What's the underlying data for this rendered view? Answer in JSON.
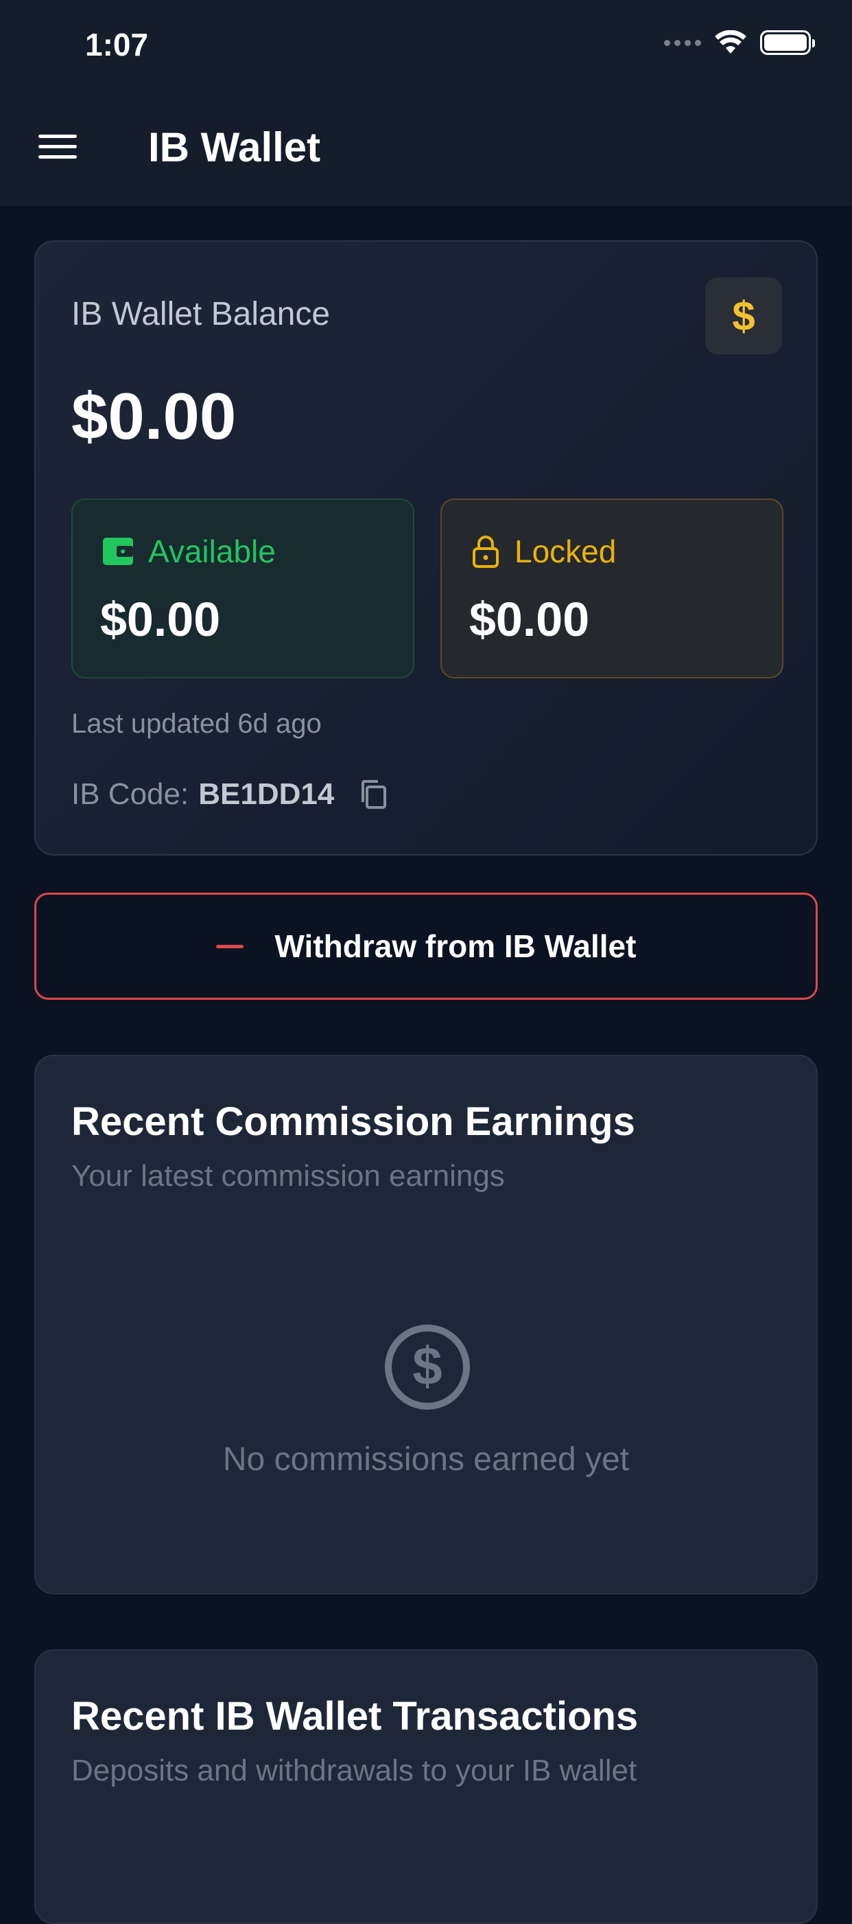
{
  "status_bar": {
    "time": "1:07"
  },
  "header": {
    "title": "IB Wallet"
  },
  "balance_card": {
    "label": "IB Wallet Balance",
    "badge": "$",
    "balance": "$0.00",
    "available_label": "Available",
    "available_value": "$0.00",
    "locked_label": "Locked",
    "locked_value": "$0.00",
    "last_updated": "Last updated 6d ago",
    "ib_code_label": "IB Code:",
    "ib_code_value": "BE1DD14"
  },
  "withdraw_button": {
    "label": "Withdraw from IB Wallet"
  },
  "commissions": {
    "title": "Recent Commission Earnings",
    "subtitle": "Your latest commission earnings",
    "empty_text": "No commissions earned yet"
  },
  "transactions": {
    "title": "Recent IB Wallet Transactions",
    "subtitle": "Deposits and withdrawals to your IB wallet"
  },
  "colors": {
    "available": "#22c55e",
    "locked": "#eab308",
    "danger": "#e04848",
    "background": "#0b1222"
  }
}
